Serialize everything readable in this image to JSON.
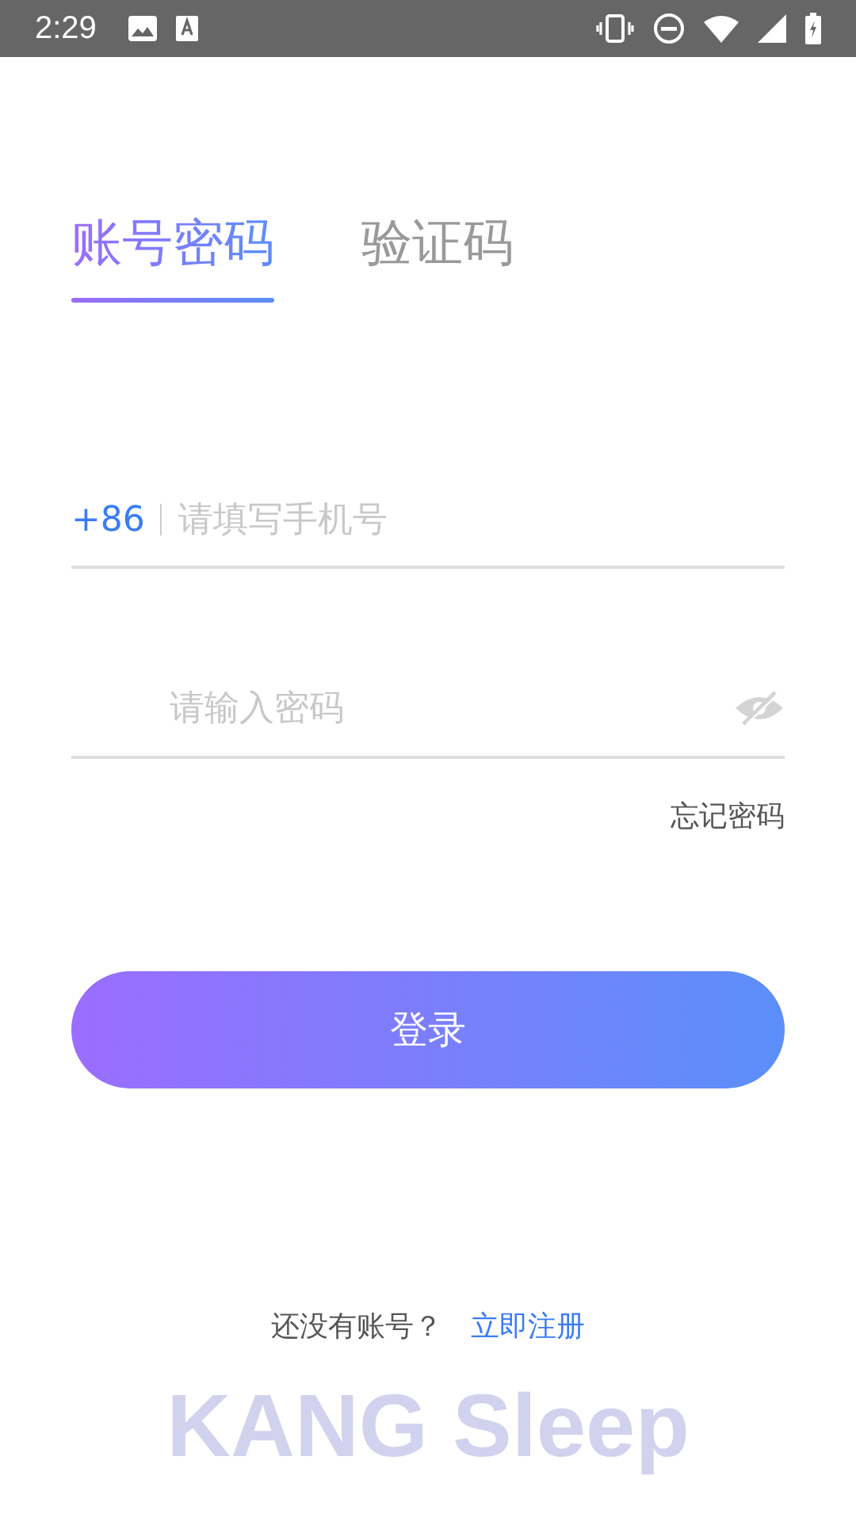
{
  "status_bar": {
    "time": "2:29"
  },
  "tabs": [
    {
      "label": "账号密码",
      "selected": true
    },
    {
      "label": "验证码",
      "selected": false
    }
  ],
  "phone_field": {
    "country_code": "+86",
    "placeholder": "请填写手机号"
  },
  "password_field": {
    "placeholder": "请输入密码",
    "visible": false
  },
  "forgot_password": "忘记密码",
  "login_button": "登录",
  "footer": {
    "prompt": "还没有账号？",
    "register_link": "立即注册"
  },
  "brand": "KANG Sleep"
}
